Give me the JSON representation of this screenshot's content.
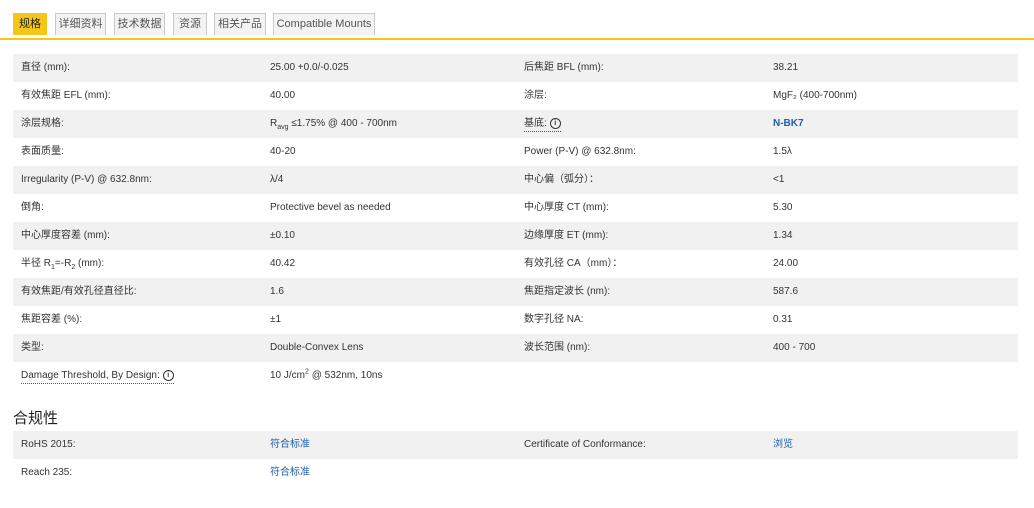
{
  "tabs": [
    "规格",
    "详细资料",
    "技术数据",
    "资源",
    "相关产品",
    "Compatible Mounts"
  ],
  "active_tab": 0,
  "specs": [
    {
      "l1": "直径 (mm):",
      "v1": "25.00 +0.0/-0.025",
      "l2": "后焦距 BFL (mm):",
      "v2": "38.21"
    },
    {
      "l1": "有效焦距 EFL (mm):",
      "v1": "40.00",
      "l2": "涂层:",
      "v2": "MgF₂ (400-700nm)"
    },
    {
      "l1": "涂层规格:",
      "v1_prefix": "R",
      "v1_sub": "avg",
      "v1_rest": " ≤1.75% @ 400 - 700nm",
      "l2": "基底:",
      "v2": "N-BK7"
    },
    {
      "l1": "表面质量:",
      "v1": "40-20",
      "l2": "Power (P-V) @ 632.8nm:",
      "v2": "1.5λ"
    },
    {
      "l1": "Irregularity (P-V) @ 632.8nm:",
      "v1": "λ/4",
      "l2": "中心偏（弧分）：",
      "v2": "<1"
    },
    {
      "l1": "倒角:",
      "v1": "Protective bevel as needed",
      "l2": "中心厚度 CT (mm):",
      "v2": "5.30"
    },
    {
      "l1": "中心厚度容差 (mm):",
      "v1": "±0.10",
      "l2": "边缘厚度 ET (mm):",
      "v2": "1.34"
    },
    {
      "l1_pre": "半径 R",
      "l1_sub1": "1",
      "l1_mid": "=-R",
      "l1_sub2": "2",
      "l1_post": " (mm):",
      "v1": "40.42",
      "l2": "有效孔径 CA（mm）：",
      "v2": "24.00"
    },
    {
      "l1": "有效焦距/有效孔径直径比:",
      "v1": "1.6",
      "l2": "焦距指定波长 (nm):",
      "v2": "587.6"
    },
    {
      "l1": "焦距容差 (%):",
      "v1": "±1",
      "l2": "数字孔径 NA:",
      "v2": "0.31"
    },
    {
      "l1": "类型:",
      "v1": "Double-Convex Lens",
      "l2": "波长范围 (nm):",
      "v2": "400 - 700"
    },
    {
      "l1": "Damage Threshold, By Design:",
      "v1_pre": "10 J/cm",
      "v1_sup": "2",
      "v1_post": " @ 532nm, 10ns",
      "l2": "",
      "v2": ""
    }
  ],
  "compliance_title": "合规性",
  "compliance": [
    {
      "l1": "RoHS 2015:",
      "v1": "符合标准",
      "l2": "Certificate of Conformance:",
      "v2": "浏览"
    },
    {
      "l1": "Reach 235:",
      "v1": "符合标准",
      "l2": "",
      "v2": ""
    }
  ],
  "info_glyph": "i",
  "colors": {
    "accent": "#f5c518",
    "link": "#1f5fa8",
    "row_shade": "#f1f1f1"
  }
}
